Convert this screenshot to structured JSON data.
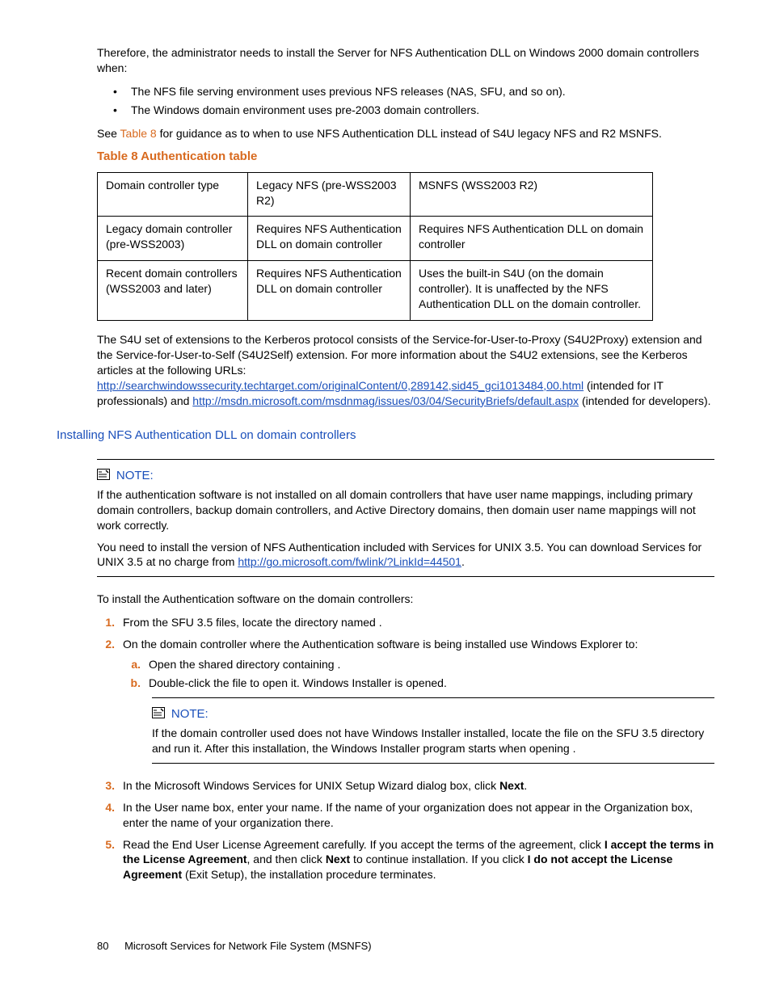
{
  "intro": {
    "p1": "Therefore, the administrator needs to install the Server for NFS Authentication DLL on Windows 2000 domain controllers when:",
    "bullets": [
      "The NFS file serving environment uses previous NFS releases (NAS, SFU, and so on).",
      "The Windows domain environment uses pre-2003 domain controllers."
    ],
    "p2_pre": "See ",
    "p2_link": "Table 8",
    "p2_post": " for guidance as to when to use NFS Authentication DLL instead of S4U legacy NFS and R2 MSNFS."
  },
  "table": {
    "caption": "Table 8 Authentication table",
    "rows": [
      [
        "Domain controller type",
        "Legacy NFS (pre-WSS2003 R2)",
        "MSNFS (WSS2003 R2)"
      ],
      [
        "Legacy domain controller (pre-WSS2003)",
        "Requires NFS Authentication DLL on domain controller",
        "Requires NFS Authentication DLL on domain controller"
      ],
      [
        "Recent domain controllers (WSS2003 and later)",
        "Requires NFS Authentication DLL on domain controller",
        "Uses the built-in S4U (on the domain controller). It is unaffected by the NFS Authentication DLL on the domain controller."
      ]
    ]
  },
  "s4u": {
    "p_pre": "The S4U set of extensions to the Kerberos protocol consists of the Service-for-User-to-Proxy (S4U2Proxy) extension and the Service-for-User-to-Self (S4U2Self) extension. For more information about the S4U2 extensions, see the Kerberos articles at the following URLs: ",
    "link1": "http://searchwindowssecurity.techtarget.com/originalContent/0,289142,sid45_gci1013484,00.html",
    "mid1": " (intended for IT professionals) and ",
    "link2": "http://msdn.microsoft.com/msdnmag/issues/03/04/SecurityBriefs/default.aspx",
    "mid2": " (intended for developers)."
  },
  "section_title": "Installing NFS Authentication DLL on domain controllers",
  "note1": {
    "label": "NOTE:",
    "p1": "If the authentication software is not installed on all domain controllers that have user name mappings, including primary domain controllers, backup domain controllers, and Active Directory domains, then domain user name mappings will not work correctly.",
    "p2_pre": "You need to install the version of NFS Authentication included with Services for UNIX 3.5. You can download Services for UNIX 3.5 at no charge from ",
    "p2_link": "http://go.microsoft.com/fwlink/?LinkId=44501",
    "p2_post": "."
  },
  "install_intro": "To install the Authentication software on the domain controllers:",
  "steps": [
    {
      "marker": "1.",
      "text": "From the SFU 3.5 files, locate the directory named                                       ."
    },
    {
      "marker": "2.",
      "text": "On the domain controller where the Authentication software is being installed use Windows Explorer to:",
      "sub": [
        {
          "marker": "a.",
          "text": "Open the shared directory containing                                ."
        },
        {
          "marker": "b.",
          "text": "Double-click the file to open it. Windows Installer is opened."
        }
      ],
      "note": {
        "label": "NOTE:",
        "body": "If the domain controller used does not have Windows Installer installed, locate the file                          on the SFU 3.5 directory and run it. After this installation, the Windows Installer program starts when opening                             ."
      }
    },
    {
      "marker": "3.",
      "html": "In the Microsoft Windows Services for UNIX Setup Wizard dialog box, click <b>Next</b>."
    },
    {
      "marker": "4.",
      "text": "In the User name box, enter your name. If the name of your organization does not appear in the Organization box, enter the name of your organization there."
    },
    {
      "marker": "5.",
      "html": "Read the End User License Agreement carefully. If you accept the terms of the agreement, click <b>I accept the terms in the License Agreement</b>, and then click <b>Next</b> to continue installation. If you click <b>I do not accept the License Agreement</b> (Exit Setup), the installation procedure terminates."
    }
  ],
  "footer": {
    "page": "80",
    "chapter": "Microsoft Services for Network File System (MSNFS)"
  }
}
